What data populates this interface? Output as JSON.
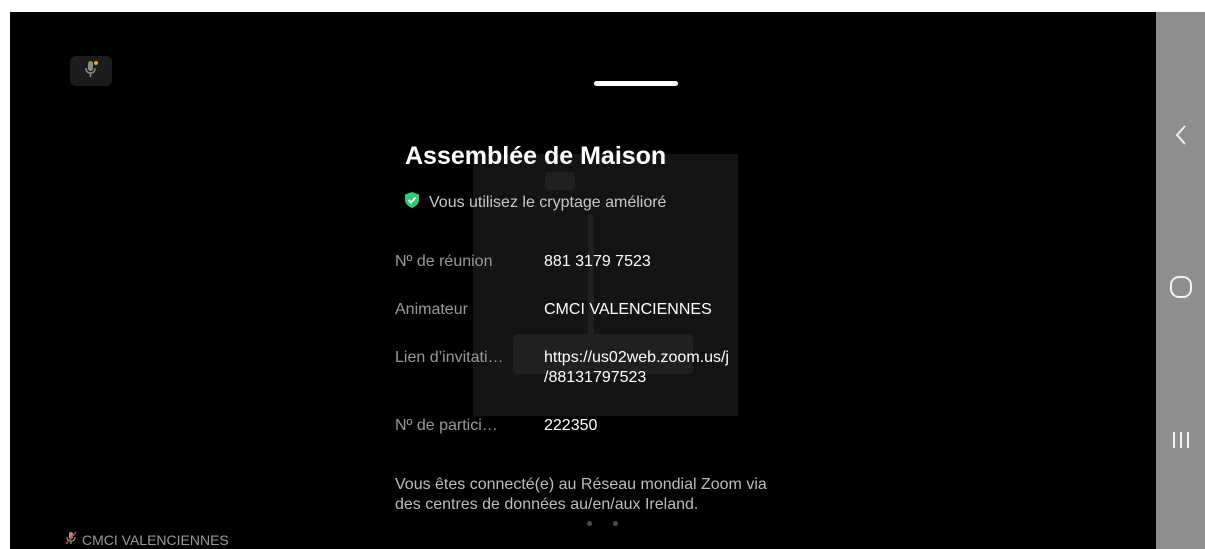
{
  "meeting": {
    "title": "Assemblée de Maison",
    "encryption_text": "Vous utilisez le cryptage amélioré",
    "encryption_icon": "shield-check-icon",
    "accent_color": "#2ecc71",
    "details": [
      {
        "label": "Nº de réunion",
        "value": "881 3179 7523"
      },
      {
        "label": "Animateur",
        "value": "CMCI VALENCIENNES"
      },
      {
        "label": "Lien d’invitati…",
        "value_line1": "https://us02web.zoom.us/j",
        "value_line2": "/88131797523"
      },
      {
        "label": "Nº de partici…",
        "value": "222350"
      }
    ],
    "network_note_line1": "Vous êtes connecté(e) au Réseau mondial Zoom via",
    "network_note_line2": "des centres de données au/en/aux Ireland."
  },
  "participant": {
    "name": "CMCI VALENCIENNES",
    "mic_icon": "mic-muted-icon"
  },
  "nav": {
    "back_icon": "back-chevron-icon",
    "home_icon": "home-icon",
    "recents_icon": "recents-icon"
  }
}
